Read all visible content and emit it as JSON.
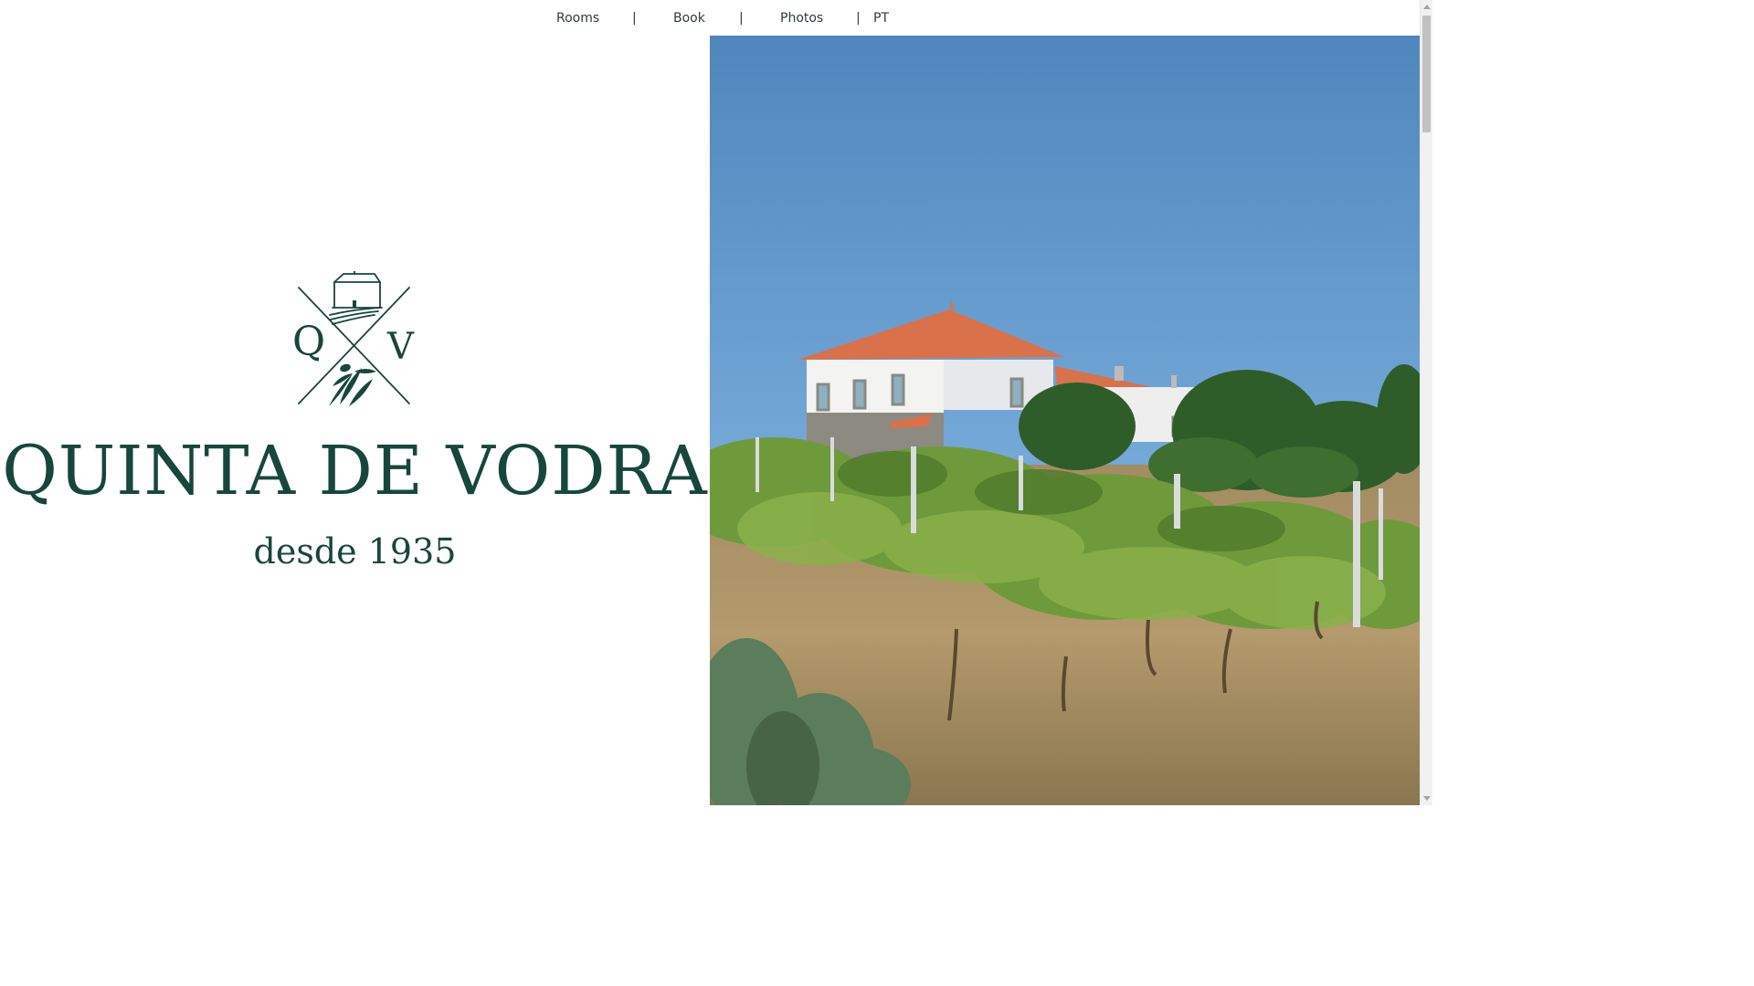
{
  "nav": {
    "items": [
      {
        "label": "Rooms"
      },
      {
        "label": "Book"
      },
      {
        "label": "Photos"
      },
      {
        "label": "PT"
      }
    ],
    "separator": "|"
  },
  "brand": {
    "logo_letters": {
      "left": "Q",
      "right": "V"
    },
    "title": "QUINTA DE VODRA",
    "subtitle": "desde 1935"
  },
  "photo": {
    "icon": "vineyard-farmhouse-photo"
  },
  "colors": {
    "brand_green": "#17463a",
    "nav_text": "#2e3b3f",
    "sky": "#5d95c9",
    "roof": "#d9714b"
  }
}
